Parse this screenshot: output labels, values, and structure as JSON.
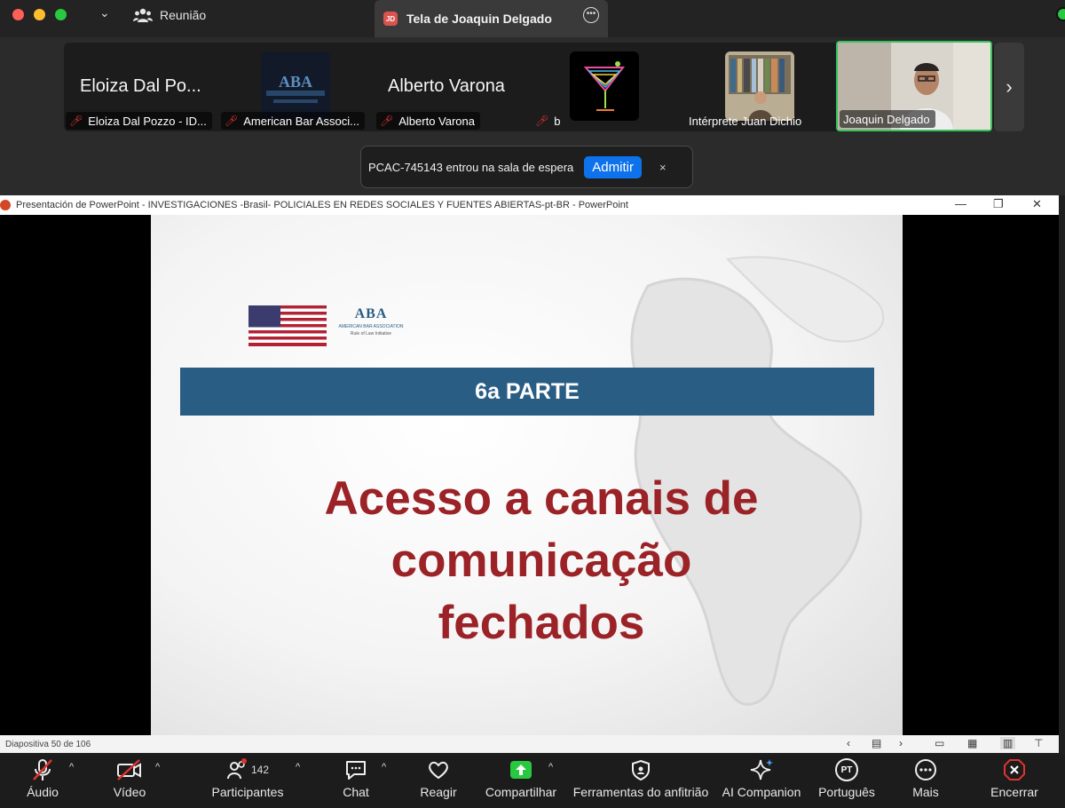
{
  "window": {
    "meeting_tab": "Reunião",
    "screen_tab": "Tela de Joaquin Delgado",
    "screen_tab_badge": "JD"
  },
  "gallery": {
    "tiles": [
      {
        "big_name": "Eloiza Dal Po...",
        "label": "Eloiza Dal Pozzo - ID..."
      },
      {
        "label": "American Bar Associ..."
      },
      {
        "big_name": "Alberto Varona",
        "label": "Alberto Varona"
      },
      {
        "label": "b"
      },
      {
        "label": "Intérprete Juan Dichio"
      },
      {
        "label": "Joaquin Delgado"
      }
    ]
  },
  "notification": {
    "message": "PCAC-745143 entrou na sala de espera",
    "admit": "Admitir",
    "close": "×"
  },
  "powerpoint": {
    "title": "Presentación de PowerPoint  -  INVESTIGACIONES -Brasil- POLICIALES EN REDES SOCIALES Y FUENTES ABIERTAS-pt-BR - PowerPoint",
    "slide_counter": "Diapositiva 50 de 106",
    "slide": {
      "band_text": "6a PARTE",
      "title_line1": "Acesso a canais de",
      "title_line2": "comunicação",
      "title_line3": "fechados",
      "logo_acronym": "ABA",
      "logo_name": "AMERICAN BAR ASSOCIATION",
      "logo_sub": "Rule of Law Initiative"
    }
  },
  "toolbar": {
    "audio": "Áudio",
    "video": "Vídeo",
    "participants": "Participantes",
    "participants_count": "142",
    "chat": "Chat",
    "react": "Reagir",
    "share": "Compartilhar",
    "host_tools": "Ferramentas do anfitrião",
    "ai": "AI Companion",
    "language": "Português",
    "language_badge": "PT",
    "more": "Mais",
    "end": "Encerrar"
  },
  "colors": {
    "accent": "#0e72ed",
    "slide_band": "#2a5d84",
    "slide_title": "#9b2226",
    "active_speaker": "#35c35b",
    "muted": "#e0332f"
  }
}
